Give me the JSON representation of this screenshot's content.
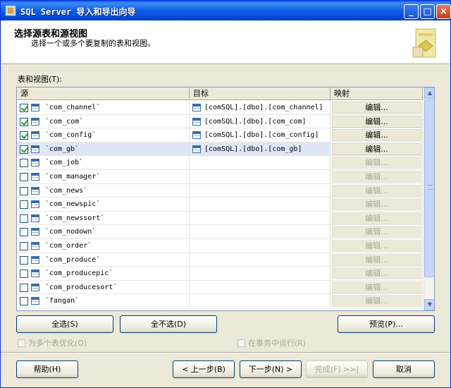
{
  "window": {
    "title": "SQL Server 导入和导出向导"
  },
  "header": {
    "title": "选择源表和源视图",
    "subtitle": "选择一个或多个要复制的表和视图。"
  },
  "grid": {
    "label": "表和视图(T):",
    "columns": {
      "source": "源",
      "target": "目标",
      "mapping": "映射"
    },
    "rows": [
      {
        "checked": true,
        "source": "`com_channel`",
        "target": "[comSQL].[dbo].[com_channel]",
        "edit": "编辑...",
        "enabled": true
      },
      {
        "checked": true,
        "source": "`com_com`",
        "target": "[comSQL].[dbo].[com_com]",
        "edit": "编辑...",
        "enabled": true
      },
      {
        "checked": true,
        "source": "`com_config`",
        "target": "[comSQL].[dbo].[com_config]",
        "edit": "编辑...",
        "enabled": true
      },
      {
        "checked": true,
        "source": "`com_gb`",
        "target": "[comSQL].[dbo].[com_gb]",
        "edit": "编辑...",
        "enabled": true,
        "selected": true
      },
      {
        "checked": false,
        "source": "`com_job`",
        "target": "",
        "edit": "编辑...",
        "enabled": false
      },
      {
        "checked": false,
        "source": "`com_manager`",
        "target": "",
        "edit": "编辑...",
        "enabled": false
      },
      {
        "checked": false,
        "source": "`com_news`",
        "target": "",
        "edit": "编辑...",
        "enabled": false
      },
      {
        "checked": false,
        "source": "`com_newspic`",
        "target": "",
        "edit": "编辑...",
        "enabled": false
      },
      {
        "checked": false,
        "source": "`com_newssort`",
        "target": "",
        "edit": "编辑...",
        "enabled": false
      },
      {
        "checked": false,
        "source": "`com_nodown`",
        "target": "",
        "edit": "编辑...",
        "enabled": false
      },
      {
        "checked": false,
        "source": "`com_order`",
        "target": "",
        "edit": "编辑...",
        "enabled": false
      },
      {
        "checked": false,
        "source": "`com_produce`",
        "target": "",
        "edit": "编辑...",
        "enabled": false
      },
      {
        "checked": false,
        "source": "`com_producepic`",
        "target": "",
        "edit": "编辑...",
        "enabled": false
      },
      {
        "checked": false,
        "source": "`com_producesort`",
        "target": "",
        "edit": "编辑...",
        "enabled": false
      },
      {
        "checked": false,
        "source": "`fangan`",
        "target": "",
        "edit": "编辑...",
        "enabled": false
      }
    ]
  },
  "actions": {
    "select_all": "全选(S)",
    "deselect_all": "全不选(D)",
    "preview": "预览(P)..."
  },
  "options": {
    "optimize_multiple": "为多个表优化(O)",
    "run_in_transaction": "在事务中运行(R)"
  },
  "footer": {
    "help": "帮助(H)",
    "back": "< 上一步(B)",
    "next": "下一步(N) >",
    "finish": "完成(F) >>|",
    "cancel": "取消"
  }
}
